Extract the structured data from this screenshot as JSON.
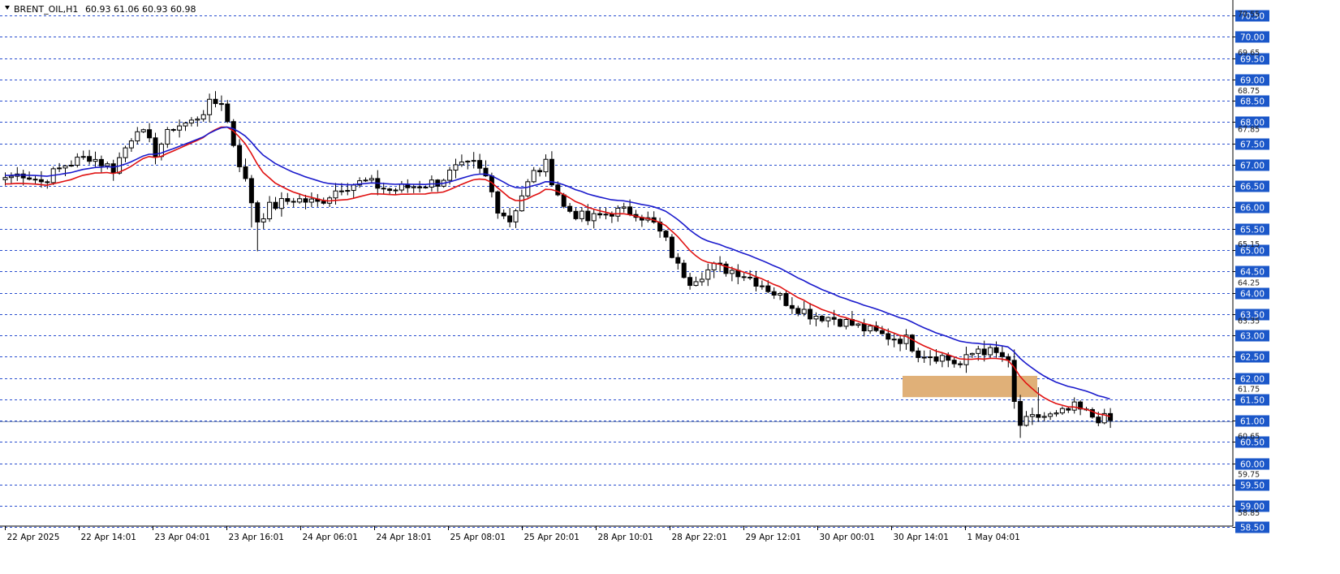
{
  "header": {
    "symbol": "BRENT_OIL,H1",
    "ohlc": "60.93 61.06 60.93 60.98",
    "collapse_icon": "triangle-down-icon"
  },
  "colors": {
    "grid": "#2a4fcf",
    "ema_fast": "#e01010",
    "ema_slow": "#1a1acc",
    "zone": "#e0b078",
    "badge": "#1b57c9",
    "candle": "#000000",
    "current_price_line": "#8898b8"
  },
  "chart_data": {
    "type": "candlestick",
    "timeframe": "H1",
    "symbol": "BRENT_OIL",
    "ylim": [
      58.5,
      70.75
    ],
    "grid": true,
    "y_ticks_badge": [
      "70.50",
      "70.00",
      "69.50",
      "69.00",
      "68.50",
      "68.00",
      "67.50",
      "67.00",
      "66.50",
      "66.00",
      "65.50",
      "65.00",
      "64.50",
      "64.00",
      "63.50",
      "63.00",
      "62.50",
      "62.00",
      "61.50",
      "61.00",
      "60.50",
      "60.00",
      "59.50",
      "59.00",
      "58.50"
    ],
    "y_ticks_minor": [
      "70.55",
      "69.65",
      "68.75",
      "67.85",
      "65.15",
      "64.25",
      "63.35",
      "61.75",
      "60.65",
      "59.75",
      "58.85"
    ],
    "x_ticks": [
      "22 Apr 2025",
      "22 Apr 14:01",
      "23 Apr 04:01",
      "23 Apr 16:01",
      "24 Apr 06:01",
      "24 Apr 18:01",
      "25 Apr 08:01",
      "25 Apr 20:01",
      "28 Apr 10:01",
      "28 Apr 22:01",
      "29 Apr 12:01",
      "30 Apr 00:01",
      "30 Apr 14:01",
      "1 May 04:01"
    ],
    "current_price": 60.98,
    "zone": {
      "from_x": "30 Apr 14:01",
      "to_x": "1 May 04:01",
      "y_low": 61.55,
      "y_high": 62.05
    },
    "ema_fast_label": "",
    "ema_slow_label": "",
    "close_anchors": [
      [
        0,
        66.7
      ],
      [
        3,
        66.8
      ],
      [
        6,
        66.6
      ],
      [
        10,
        67.0
      ],
      [
        14,
        67.2
      ],
      [
        18,
        66.9
      ],
      [
        22,
        67.9
      ],
      [
        25,
        67.3
      ],
      [
        28,
        67.9
      ],
      [
        31,
        68.0
      ],
      [
        34,
        68.4
      ],
      [
        36,
        68.5
      ],
      [
        38,
        67.5
      ],
      [
        40,
        66.6
      ],
      [
        42,
        65.7
      ],
      [
        44,
        66.0
      ],
      [
        48,
        66.2
      ],
      [
        52,
        66.1
      ],
      [
        56,
        66.5
      ],
      [
        60,
        66.6
      ],
      [
        64,
        66.4
      ],
      [
        68,
        66.5
      ],
      [
        72,
        66.6
      ],
      [
        75,
        66.9
      ],
      [
        78,
        67.0
      ],
      [
        80,
        66.7
      ],
      [
        82,
        66.0
      ],
      [
        84,
        65.7
      ],
      [
        86,
        66.3
      ],
      [
        88,
        66.8
      ],
      [
        90,
        67.0
      ],
      [
        93,
        66.0
      ],
      [
        97,
        65.7
      ],
      [
        101,
        65.9
      ],
      [
        105,
        65.9
      ],
      [
        108,
        65.6
      ],
      [
        110,
        65.2
      ],
      [
        112,
        64.6
      ],
      [
        114,
        64.3
      ],
      [
        118,
        64.6
      ],
      [
        122,
        64.5
      ],
      [
        126,
        64.2
      ],
      [
        130,
        63.8
      ],
      [
        134,
        63.5
      ],
      [
        138,
        63.4
      ],
      [
        142,
        63.2
      ],
      [
        146,
        63.0
      ],
      [
        150,
        62.9
      ],
      [
        152,
        62.6
      ],
      [
        156,
        62.5
      ],
      [
        159,
        62.3
      ],
      [
        162,
        62.7
      ],
      [
        166,
        62.5
      ],
      [
        167,
        62.3
      ],
      [
        168,
        61.4
      ],
      [
        169,
        60.9
      ],
      [
        172,
        61.1
      ],
      [
        175,
        61.1
      ],
      [
        178,
        61.3
      ],
      [
        181,
        61.1
      ],
      [
        184,
        61.0
      ]
    ]
  }
}
